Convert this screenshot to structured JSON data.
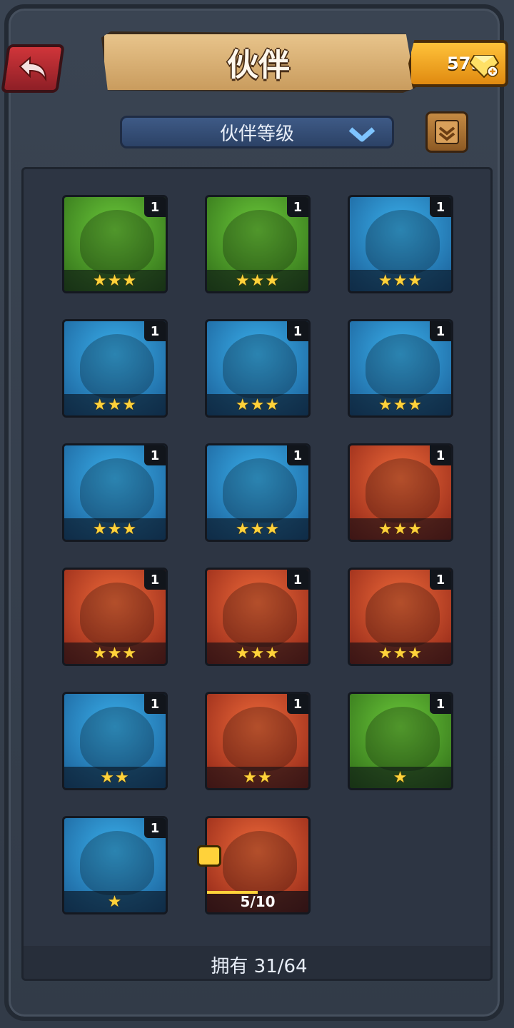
{
  "header": {
    "title": "伙伴",
    "gems": "579",
    "back_icon": "back-arrow-icon",
    "gem_icon": "diamond-icon"
  },
  "filter": {
    "selected": "伙伴等级",
    "icon": "chevron-down-icon"
  },
  "map_button_icon": "map-icon",
  "partners": [
    {
      "level": "1",
      "stars": "★★★",
      "bg": "green",
      "portrait": "skull-hood-woman"
    },
    {
      "level": "1",
      "stars": "★★★",
      "bg": "green",
      "portrait": "skull-hood-woman"
    },
    {
      "level": "1",
      "stars": "★★★",
      "bg": "blue",
      "portrait": "mohawk-brute"
    },
    {
      "level": "1",
      "stars": "★★★",
      "bg": "blue",
      "portrait": "werewolf"
    },
    {
      "level": "1",
      "stars": "★★★",
      "bg": "blue",
      "portrait": "boar-beast"
    },
    {
      "level": "1",
      "stars": "★★★",
      "bg": "blue",
      "portrait": "boar-beast"
    },
    {
      "level": "1",
      "stars": "★★★",
      "bg": "blue",
      "portrait": "lizard-beast"
    },
    {
      "level": "1",
      "stars": "★★★",
      "bg": "blue",
      "portrait": "braided-elf"
    },
    {
      "level": "1",
      "stars": "★★★",
      "bg": "red",
      "portrait": "warpaint-brute"
    },
    {
      "level": "1",
      "stars": "★★★",
      "bg": "red",
      "portrait": "boar-beast"
    },
    {
      "level": "1",
      "stars": "★★★",
      "bg": "red",
      "portrait": "boar-beast"
    },
    {
      "level": "1",
      "stars": "★★★",
      "bg": "red",
      "portrait": "skull-hood-woman"
    },
    {
      "level": "1",
      "stars": "★★",
      "bg": "blue",
      "portrait": "eyeball-slime"
    },
    {
      "level": "1",
      "stars": "★★",
      "bg": "red",
      "portrait": "eyeball-slime"
    },
    {
      "level": "1",
      "stars": "★",
      "bg": "green",
      "portrait": "eyeball-slime"
    },
    {
      "level": "1",
      "stars": "★",
      "bg": "blue",
      "portrait": "eyeball-slime"
    }
  ],
  "locked_partner": {
    "progress": "5/10",
    "fraction": 0.5,
    "bg": "red",
    "portrait": "blonde-warrior",
    "badge_icon": "puzzle-piece-icon"
  },
  "footer": {
    "owned": "拥有 31/64"
  }
}
